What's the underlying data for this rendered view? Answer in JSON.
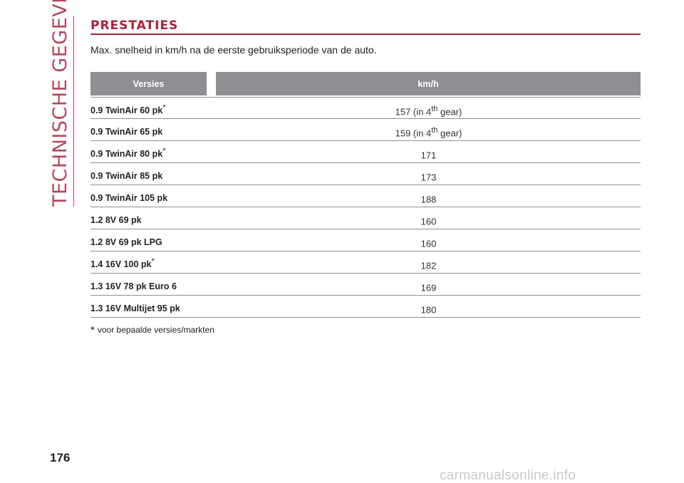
{
  "sidebar": {
    "section_title": "TECHNISCHE GEGEVENS"
  },
  "heading": "PRESTATIES",
  "subtitle": "Max. snelheid in km/h na de eerste gebruiksperiode van de auto.",
  "table": {
    "columns": [
      "Versies",
      "km/h"
    ],
    "rows": [
      {
        "version": "0.9 TwinAir 60 pk",
        "marker": "*",
        "value": "157 (in 4",
        "sup": "th",
        "suffix": " gear)"
      },
      {
        "version": "0.9 TwinAir 65 pk",
        "marker": "",
        "value": "159 (in 4",
        "sup": "th",
        "suffix": " gear)"
      },
      {
        "version": "0.9 TwinAir 80 pk",
        "marker": "*",
        "value": "171",
        "sup": "",
        "suffix": ""
      },
      {
        "version": "0.9 TwinAir 85 pk",
        "marker": "",
        "value": "173",
        "sup": "",
        "suffix": ""
      },
      {
        "version": "0.9 TwinAir 105 pk",
        "marker": "",
        "value": "188",
        "sup": "",
        "suffix": ""
      },
      {
        "version": "1.2 8V 69 pk",
        "marker": "",
        "value": "160",
        "sup": "",
        "suffix": ""
      },
      {
        "version": "1.2 8V 69 pk LPG",
        "marker": "",
        "value": "160",
        "sup": "",
        "suffix": ""
      },
      {
        "version": "1.4 16V 100 pk",
        "marker": "*",
        "value": "182",
        "sup": "",
        "suffix": ""
      },
      {
        "version": "1.3 16V 78 pk Euro 6",
        "marker": "",
        "value": "169",
        "sup": "",
        "suffix": ""
      },
      {
        "version": "1.3 16V Multijet 95 pk",
        "marker": "",
        "value": "180",
        "sup": "",
        "suffix": ""
      }
    ]
  },
  "footnote": {
    "marker": "*",
    "text": "voor bepaalde versies/markten"
  },
  "page_number": "176",
  "watermark": "carmanualsonline.info",
  "colors": {
    "accent": "#a8213f",
    "header_bg": "#8d8f92"
  }
}
